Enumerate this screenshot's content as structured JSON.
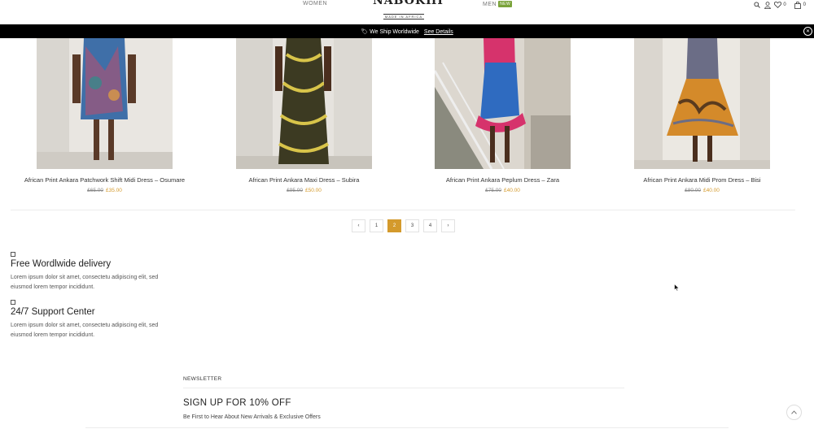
{
  "header": {
    "nav_women": "WOMEN",
    "nav_men": "MEN",
    "men_badge": "NEW",
    "logo_main": "NABOKHI",
    "logo_sub": "MADE IN AFRICA",
    "wishlist_count": "0",
    "cart_count": "0",
    "icons": [
      "search-icon",
      "user-icon",
      "heart-icon",
      "bag-icon"
    ]
  },
  "shipbar": {
    "text": "🏷 We Ship Worldwide",
    "link": "See Details"
  },
  "products": [
    {
      "name": "African Print Ankara Patchwork Shift Midi Dress – Osumare",
      "old_price": "£65.00",
      "price": "£35.00"
    },
    {
      "name": "African Print Ankara Maxi Dress – Subira",
      "old_price": "£95.00",
      "price": "£50.00"
    },
    {
      "name": "African Print Ankara Peplum Dress – Zara",
      "old_price": "£75.00",
      "price": "£40.00"
    },
    {
      "name": "African Print Ankara Midi Prom Dress – Bisi",
      "old_price": "£80.00",
      "price": "£40.00"
    }
  ],
  "pagination": {
    "prev": "‹",
    "pages": [
      "1",
      "2",
      "3",
      "4"
    ],
    "current": "2",
    "next": "›"
  },
  "features": [
    {
      "title": "Free Wordlwide delivery",
      "text": "Lorem ipsum dolor sit amet, consectetu adipiscing elit, sed eiusmod lorem tempor incididunt."
    },
    {
      "title": "24/7 Support Center",
      "text": "Lorem ipsum dolor sit amet, consectetu adipiscing elit, sed eiusmod lorem tempor incididunt."
    }
  ],
  "newsletter": {
    "label": "NEWSLETTER",
    "title": "SIGN UP FOR 10% OFF",
    "subtitle": "Be First to Hear About New Arrivals & Exclusive Offers"
  },
  "colors": {
    "accent": "#d49a2c",
    "badge": "#7aa33a",
    "bar": "#000000"
  }
}
